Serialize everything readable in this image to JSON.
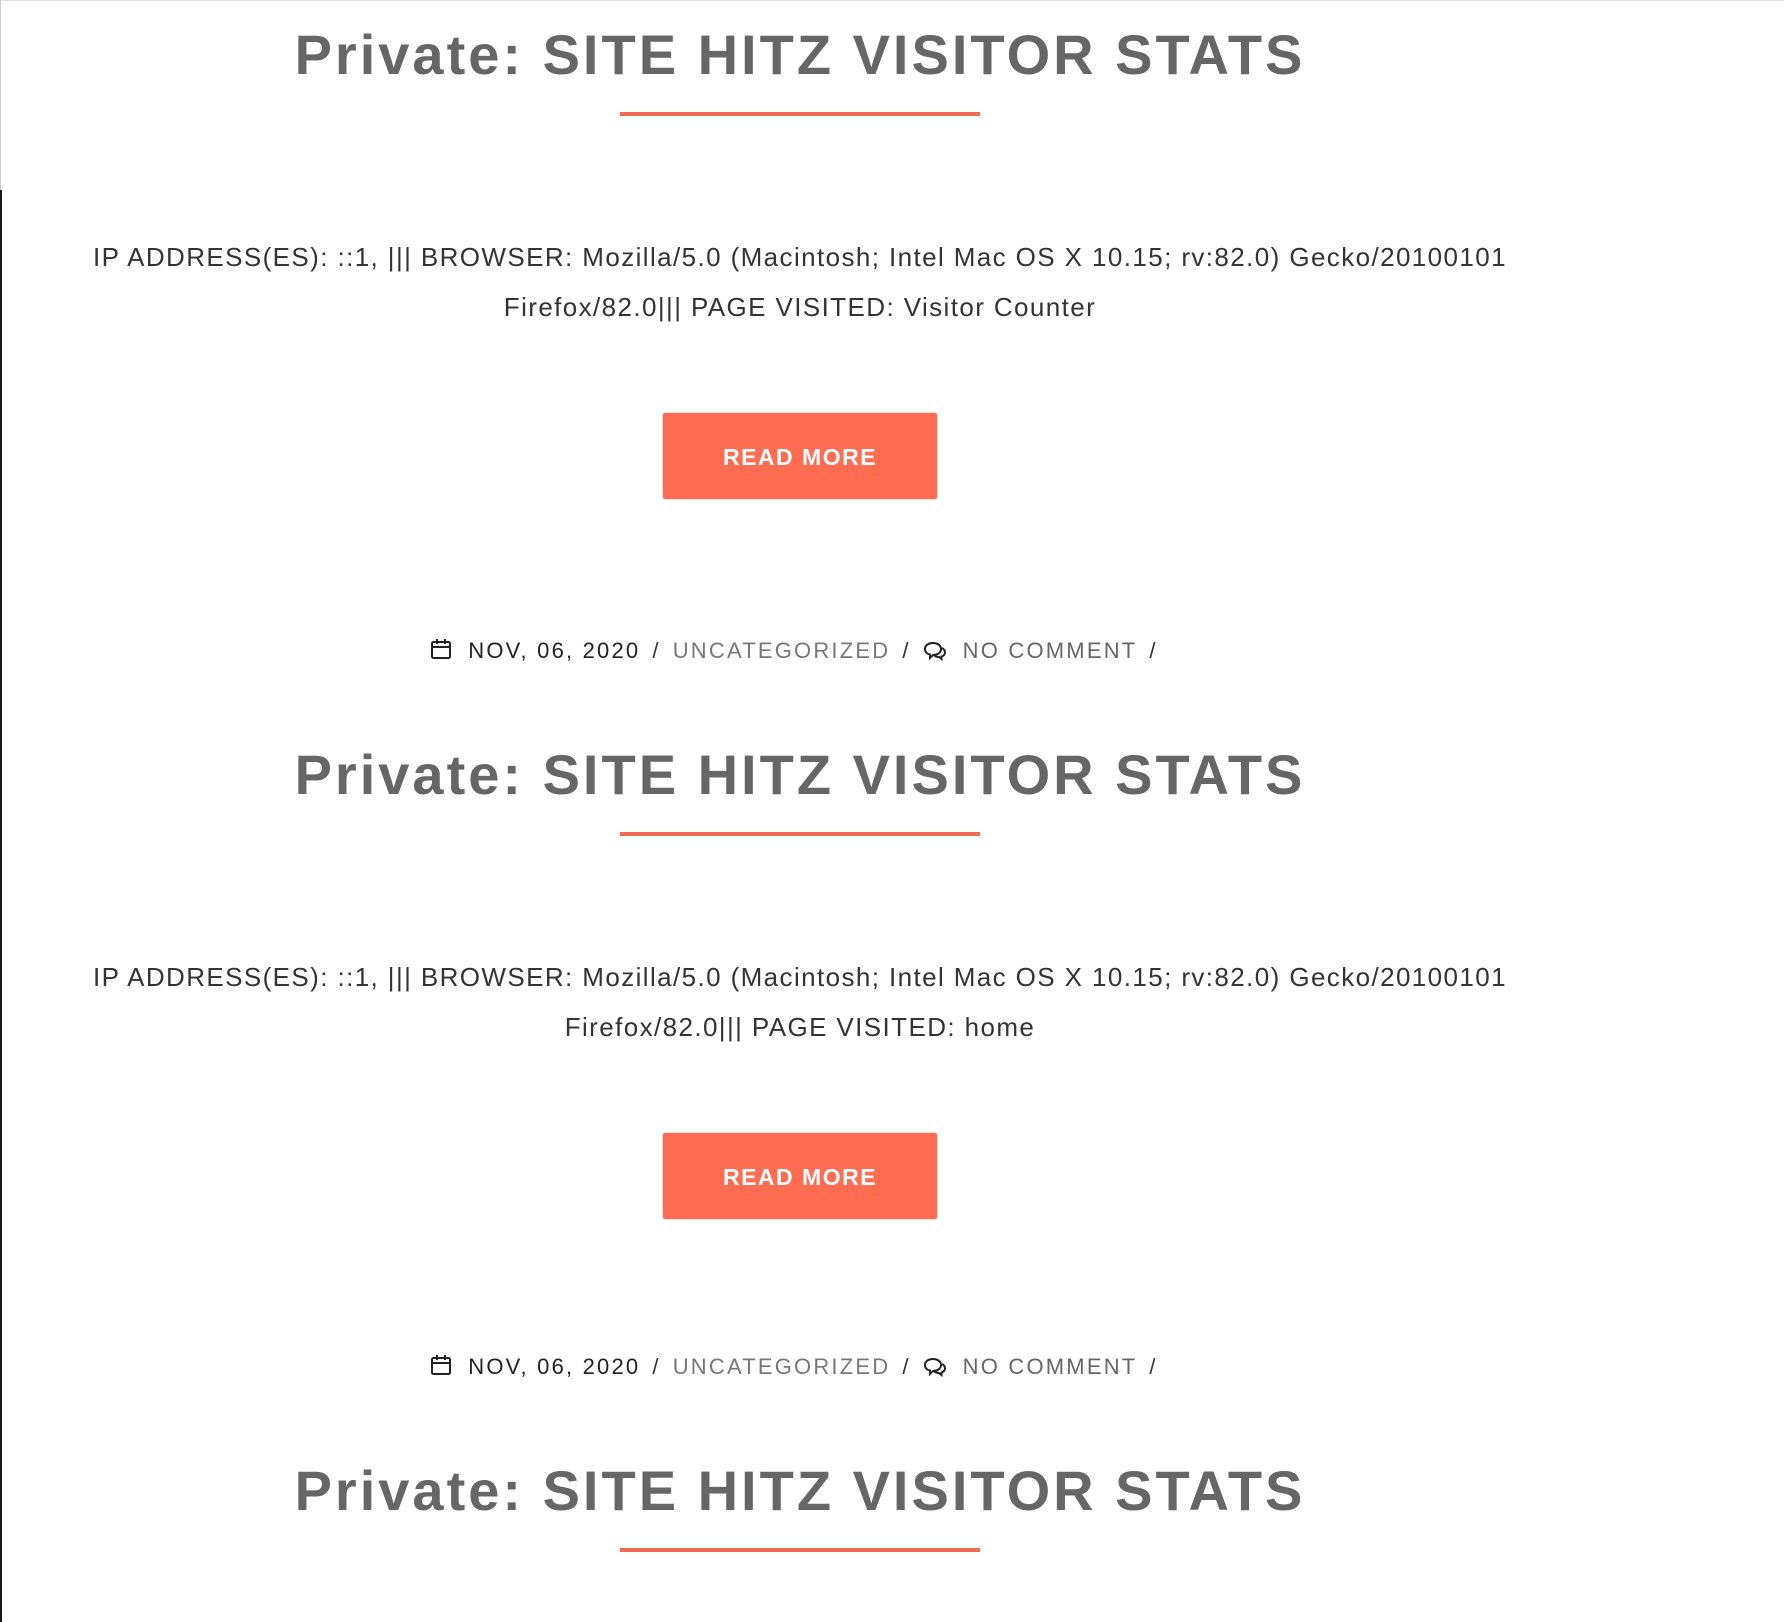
{
  "posts": [
    {
      "meta": null,
      "title_prefix": "Private:",
      "title_main": "SITE HITZ VISITOR STATS",
      "excerpt_line1": "IP ADDRESS(ES): ::1, ||| BROWSER: Mozilla/5.0 (Macintosh; Intel Mac OS X 10.15; rv:82.0) Gecko/20100101",
      "excerpt_line2": "Firefox/82.0||| PAGE VISITED: Visitor Counter",
      "read_more_label": "READ MORE"
    },
    {
      "meta": {
        "date": "NOV, 06, 2020",
        "category": "UNCATEGORIZED",
        "comments": "NO COMMENT",
        "separator": "/"
      },
      "title_prefix": "Private:",
      "title_main": "SITE HITZ VISITOR STATS",
      "excerpt_line1": "IP ADDRESS(ES): ::1, ||| BROWSER: Mozilla/5.0 (Macintosh; Intel Mac OS X 10.15; rv:82.0) Gecko/20100101",
      "excerpt_line2": "Firefox/82.0||| PAGE VISITED: home",
      "read_more_label": "READ MORE"
    },
    {
      "meta": {
        "date": "NOV, 06, 2020",
        "category": "UNCATEGORIZED",
        "comments": "NO COMMENT",
        "separator": "/"
      },
      "title_prefix": "Private:",
      "title_main": "SITE HITZ VISITOR STATS"
    }
  ],
  "icons": {
    "calendar": "calendar-icon",
    "comment": "comment-icon"
  },
  "colors": {
    "accent": "#fe6d52",
    "underline": "#f26b51",
    "title": "#666666",
    "text": "#333333"
  }
}
